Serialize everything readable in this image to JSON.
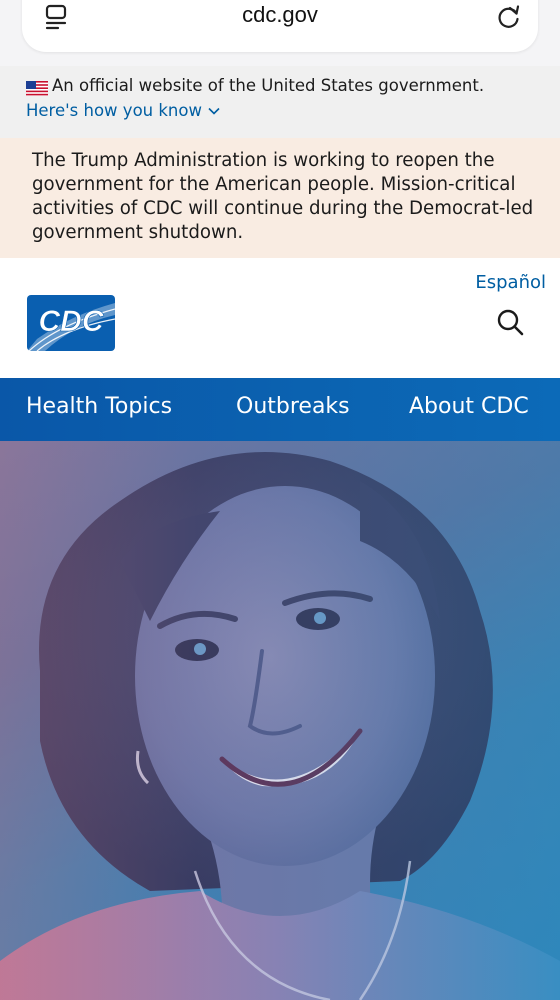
{
  "browser": {
    "url": "cdc.gov",
    "tabs_icon": "tabs-icon",
    "reload_icon": "reload-icon"
  },
  "gov_banner": {
    "flag_icon": "us-flag-icon",
    "text": "An official website of the United States government.",
    "link_label": "Here's how you know",
    "link_icon": "chevron-down-icon"
  },
  "alert": {
    "text": "The Trump Administration is working to reopen the government for the American people. Mission-critical activities of CDC will continue during the Democrat-led government shutdown."
  },
  "header": {
    "logo_text": "CDC",
    "language_link": "Español",
    "search_icon": "search-icon"
  },
  "nav": {
    "items": [
      {
        "label": "Health Topics"
      },
      {
        "label": "Outbreaks"
      },
      {
        "label": "About CDC"
      }
    ]
  },
  "hero": {
    "image": "smiling-woman-photo"
  },
  "colors": {
    "link_blue": "#005ea2",
    "nav_blue": "#0b62b0",
    "alert_bg": "#f9ece2",
    "banner_bg": "#f0f0f0",
    "logo_blue": "#0a5fb0"
  }
}
